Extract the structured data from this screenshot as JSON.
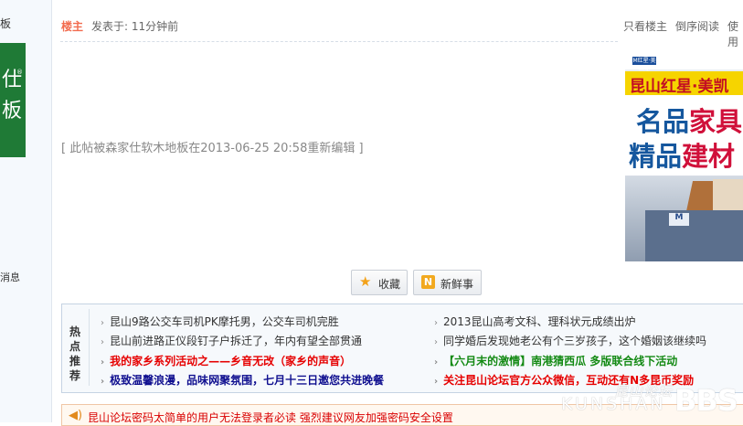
{
  "sidebar": {
    "top_char": "板",
    "logo_char1": "仕",
    "logo_char2": "板",
    "logo_reg": "®",
    "msg_label": "消息"
  },
  "post": {
    "author_tag": "楼主",
    "posted_time": "发表于: 11分钟前",
    "header_links": [
      "只看楼主",
      "倒序阅读",
      "使用"
    ],
    "edit_note": "[ 此帖被森家仕软木地板在2013-06-25 20:58重新编辑 ]"
  },
  "ad": {
    "badge": "M红星·美凯龙",
    "band_text": "昆山红星·美凯",
    "line1_a": "名品",
    "line1_b": "家具",
    "line2_a": "精品",
    "line2_b": "建材",
    "building_label": "M"
  },
  "actions": {
    "favorite_label": "收藏",
    "fresh_label": "新鲜事",
    "fresh_icon": "N"
  },
  "hot": {
    "label": "热点推荐",
    "items": [
      {
        "text": "昆山9路公交车司机PK摩托男，公交车司机完胜",
        "style": "normal"
      },
      {
        "text": "2013昆山高考文科、理科状元成绩出炉",
        "style": "normal"
      },
      {
        "text": "昆山前进路正仪段钉子户拆迁了，年内有望全部贯通",
        "style": "normal"
      },
      {
        "text": "同学婚后发现她老公有个三岁孩子，这个婚姻该继续吗",
        "style": "normal"
      },
      {
        "text": "我的家乡系列活动之——乡音无改（家乡的声音）",
        "style": "red"
      },
      {
        "text": "【六月末的激情】南港猜西瓜 多版联合线下活动",
        "style": "green"
      },
      {
        "text": "极致温馨浪漫，品味网聚氛围，七月十三日邀您共进晚餐",
        "style": "darkblue"
      },
      {
        "text": "关注昆山论坛官方公众微信，互动还有N多昆币奖励",
        "style": "red"
      }
    ]
  },
  "notice": {
    "text": "昆山论坛密码太简单的用户无法登录者必读 强烈建议网友加强密码安全设置"
  },
  "watermark": {
    "cn": "昆山论坛",
    "en": "KUNSHAN",
    "bbs": "BBS"
  }
}
